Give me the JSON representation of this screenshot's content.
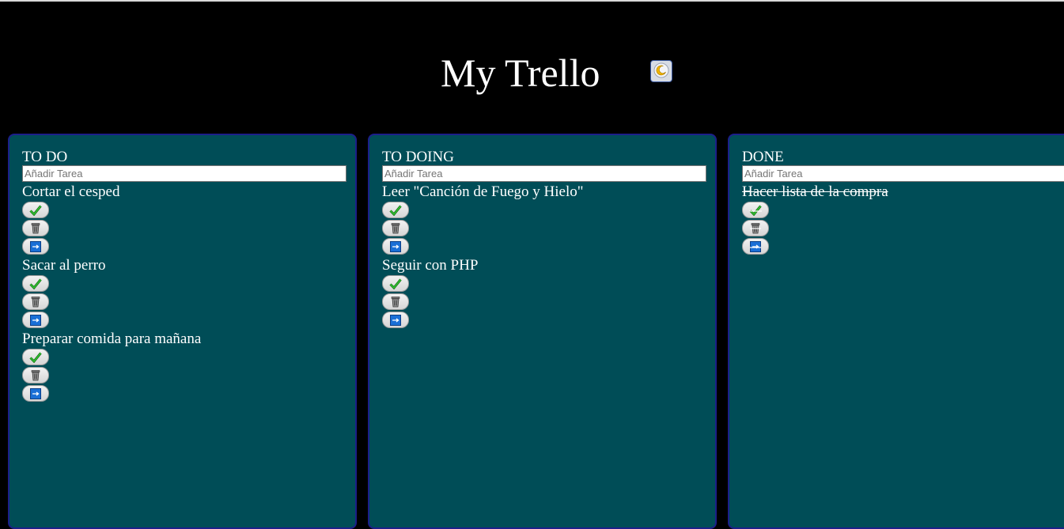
{
  "app": {
    "title": "My Trello",
    "theme_icon": "crescent-moon-icon"
  },
  "colors": {
    "page_bg": "#000000",
    "column_bg": "#004d57",
    "column_border": "#1c1f8a",
    "text": "#ffffff",
    "check_green": "#1a8f1a",
    "move_blue": "#1a6fd6"
  },
  "columns": [
    {
      "title": "TO DO",
      "input_placeholder": "Añadir Tarea",
      "tasks": [
        {
          "text": "Cortar el cesped",
          "done": false
        },
        {
          "text": "Sacar al perro",
          "done": false
        },
        {
          "text": "Preparar comida para mañana",
          "done": false
        }
      ]
    },
    {
      "title": "TO DOING",
      "input_placeholder": "Añadir Tarea",
      "tasks": [
        {
          "text": "Leer \"Canción de Fuego y Hielo\"",
          "done": false
        },
        {
          "text": "Seguir con PHP",
          "done": false
        }
      ]
    },
    {
      "title": "DONE",
      "input_placeholder": "Añadir Tarea",
      "tasks": [
        {
          "text": "Hacer lista de la compra",
          "done": true
        }
      ]
    }
  ],
  "task_buttons": [
    "check-icon",
    "trash-icon",
    "move-arrow-icon"
  ]
}
